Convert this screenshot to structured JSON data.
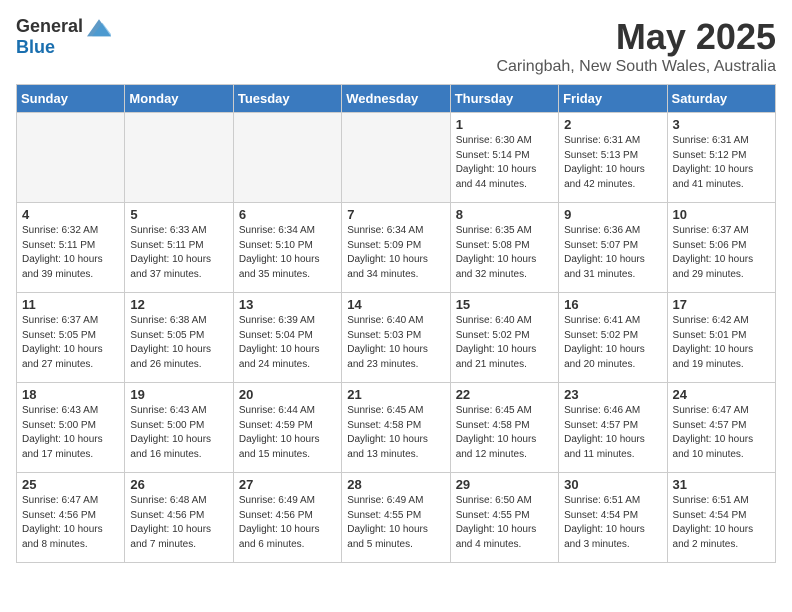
{
  "header": {
    "logo_general": "General",
    "logo_blue": "Blue",
    "month": "May 2025",
    "location": "Caringbah, New South Wales, Australia"
  },
  "weekdays": [
    "Sunday",
    "Monday",
    "Tuesday",
    "Wednesday",
    "Thursday",
    "Friday",
    "Saturday"
  ],
  "weeks": [
    [
      {
        "day": "",
        "info": ""
      },
      {
        "day": "",
        "info": ""
      },
      {
        "day": "",
        "info": ""
      },
      {
        "day": "",
        "info": ""
      },
      {
        "day": "1",
        "info": "Sunrise: 6:30 AM\nSunset: 5:14 PM\nDaylight: 10 hours\nand 44 minutes."
      },
      {
        "day": "2",
        "info": "Sunrise: 6:31 AM\nSunset: 5:13 PM\nDaylight: 10 hours\nand 42 minutes."
      },
      {
        "day": "3",
        "info": "Sunrise: 6:31 AM\nSunset: 5:12 PM\nDaylight: 10 hours\nand 41 minutes."
      }
    ],
    [
      {
        "day": "4",
        "info": "Sunrise: 6:32 AM\nSunset: 5:11 PM\nDaylight: 10 hours\nand 39 minutes."
      },
      {
        "day": "5",
        "info": "Sunrise: 6:33 AM\nSunset: 5:11 PM\nDaylight: 10 hours\nand 37 minutes."
      },
      {
        "day": "6",
        "info": "Sunrise: 6:34 AM\nSunset: 5:10 PM\nDaylight: 10 hours\nand 35 minutes."
      },
      {
        "day": "7",
        "info": "Sunrise: 6:34 AM\nSunset: 5:09 PM\nDaylight: 10 hours\nand 34 minutes."
      },
      {
        "day": "8",
        "info": "Sunrise: 6:35 AM\nSunset: 5:08 PM\nDaylight: 10 hours\nand 32 minutes."
      },
      {
        "day": "9",
        "info": "Sunrise: 6:36 AM\nSunset: 5:07 PM\nDaylight: 10 hours\nand 31 minutes."
      },
      {
        "day": "10",
        "info": "Sunrise: 6:37 AM\nSunset: 5:06 PM\nDaylight: 10 hours\nand 29 minutes."
      }
    ],
    [
      {
        "day": "11",
        "info": "Sunrise: 6:37 AM\nSunset: 5:05 PM\nDaylight: 10 hours\nand 27 minutes."
      },
      {
        "day": "12",
        "info": "Sunrise: 6:38 AM\nSunset: 5:05 PM\nDaylight: 10 hours\nand 26 minutes."
      },
      {
        "day": "13",
        "info": "Sunrise: 6:39 AM\nSunset: 5:04 PM\nDaylight: 10 hours\nand 24 minutes."
      },
      {
        "day": "14",
        "info": "Sunrise: 6:40 AM\nSunset: 5:03 PM\nDaylight: 10 hours\nand 23 minutes."
      },
      {
        "day": "15",
        "info": "Sunrise: 6:40 AM\nSunset: 5:02 PM\nDaylight: 10 hours\nand 21 minutes."
      },
      {
        "day": "16",
        "info": "Sunrise: 6:41 AM\nSunset: 5:02 PM\nDaylight: 10 hours\nand 20 minutes."
      },
      {
        "day": "17",
        "info": "Sunrise: 6:42 AM\nSunset: 5:01 PM\nDaylight: 10 hours\nand 19 minutes."
      }
    ],
    [
      {
        "day": "18",
        "info": "Sunrise: 6:43 AM\nSunset: 5:00 PM\nDaylight: 10 hours\nand 17 minutes."
      },
      {
        "day": "19",
        "info": "Sunrise: 6:43 AM\nSunset: 5:00 PM\nDaylight: 10 hours\nand 16 minutes."
      },
      {
        "day": "20",
        "info": "Sunrise: 6:44 AM\nSunset: 4:59 PM\nDaylight: 10 hours\nand 15 minutes."
      },
      {
        "day": "21",
        "info": "Sunrise: 6:45 AM\nSunset: 4:58 PM\nDaylight: 10 hours\nand 13 minutes."
      },
      {
        "day": "22",
        "info": "Sunrise: 6:45 AM\nSunset: 4:58 PM\nDaylight: 10 hours\nand 12 minutes."
      },
      {
        "day": "23",
        "info": "Sunrise: 6:46 AM\nSunset: 4:57 PM\nDaylight: 10 hours\nand 11 minutes."
      },
      {
        "day": "24",
        "info": "Sunrise: 6:47 AM\nSunset: 4:57 PM\nDaylight: 10 hours\nand 10 minutes."
      }
    ],
    [
      {
        "day": "25",
        "info": "Sunrise: 6:47 AM\nSunset: 4:56 PM\nDaylight: 10 hours\nand 8 minutes."
      },
      {
        "day": "26",
        "info": "Sunrise: 6:48 AM\nSunset: 4:56 PM\nDaylight: 10 hours\nand 7 minutes."
      },
      {
        "day": "27",
        "info": "Sunrise: 6:49 AM\nSunset: 4:56 PM\nDaylight: 10 hours\nand 6 minutes."
      },
      {
        "day": "28",
        "info": "Sunrise: 6:49 AM\nSunset: 4:55 PM\nDaylight: 10 hours\nand 5 minutes."
      },
      {
        "day": "29",
        "info": "Sunrise: 6:50 AM\nSunset: 4:55 PM\nDaylight: 10 hours\nand 4 minutes."
      },
      {
        "day": "30",
        "info": "Sunrise: 6:51 AM\nSunset: 4:54 PM\nDaylight: 10 hours\nand 3 minutes."
      },
      {
        "day": "31",
        "info": "Sunrise: 6:51 AM\nSunset: 4:54 PM\nDaylight: 10 hours\nand 2 minutes."
      }
    ]
  ]
}
